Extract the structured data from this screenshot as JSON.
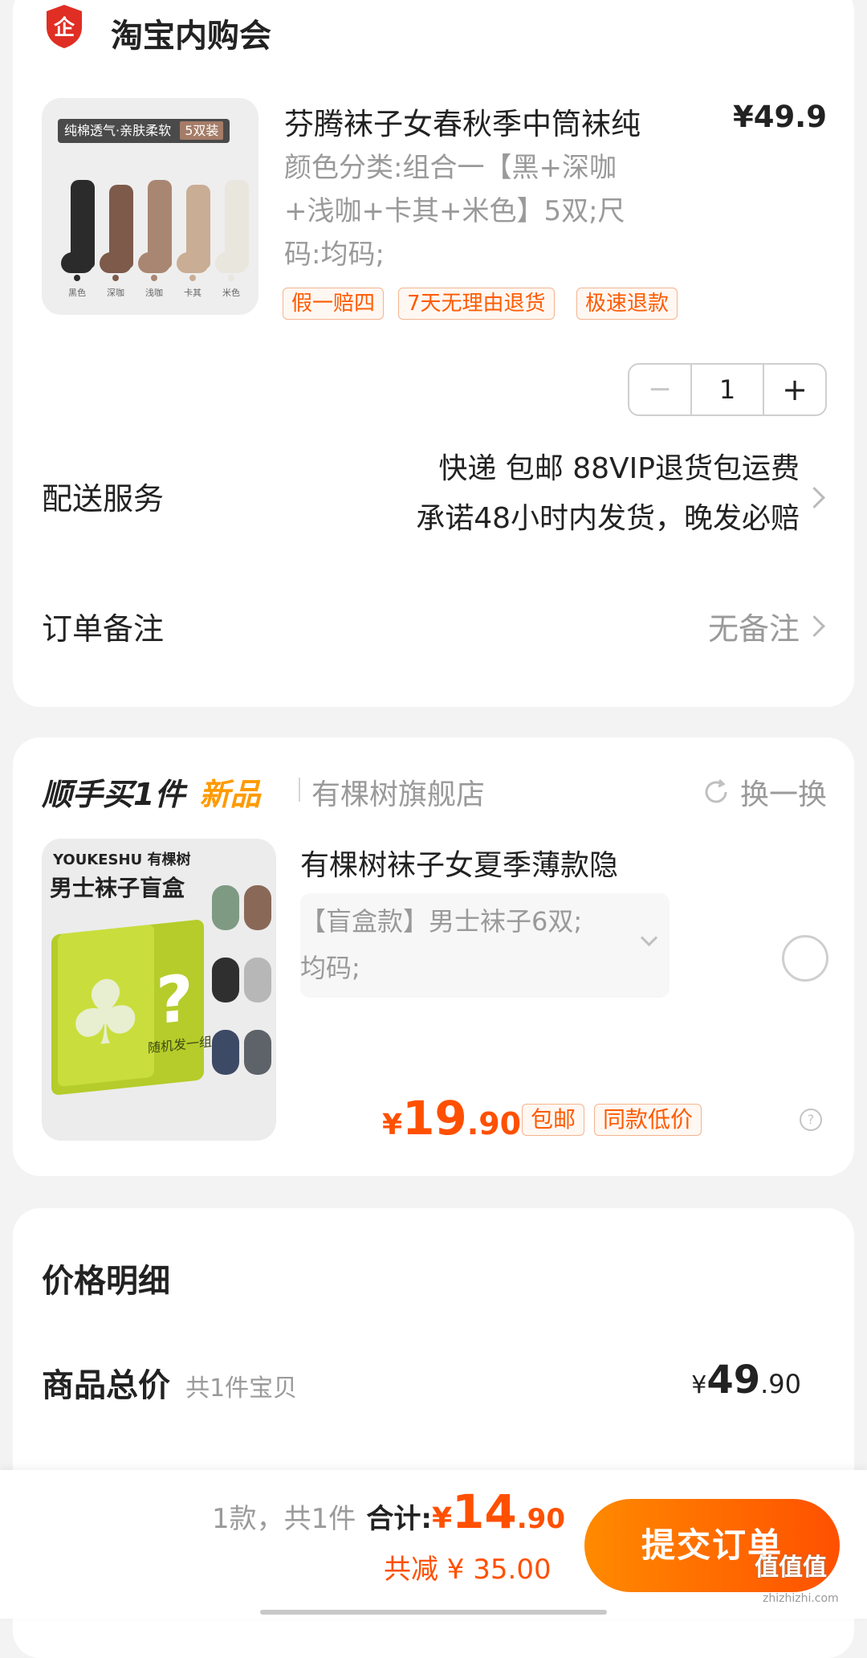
{
  "shop": {
    "name": "淘宝内购会",
    "badge_glyph": "企"
  },
  "product": {
    "title": "芬腾袜子女春秋季中筒袜纯",
    "price": "¥49.9",
    "sku_lines": [
      "颜色分类:组合一【黑+深咖",
      "+浅咖+卡其+米色】5双;尺",
      "码:均码;"
    ],
    "tags": [
      "假一赔四",
      "7天无理由退货",
      "极速退款"
    ],
    "image_banner": "纯棉透气·亲肤柔软",
    "image_badge": "5双装",
    "sock_colors": [
      {
        "label": "黑色",
        "color": "#2b2b2b"
      },
      {
        "label": "深咖",
        "color": "#7d5a4a"
      },
      {
        "label": "浅咖",
        "color": "#a98672"
      },
      {
        "label": "卡其",
        "color": "#c9ad94"
      },
      {
        "label": "米色",
        "color": "#e9e6de"
      }
    ],
    "quantity": "1",
    "minus_glyph": "−",
    "plus_glyph": "+"
  },
  "delivery": {
    "label": "配送服务",
    "line1": "快递 包邮 88VIP退货包运费",
    "line2": "承诺48小时内发货，晚发必赔"
  },
  "remark": {
    "label": "订单备注",
    "value": "无备注"
  },
  "addon": {
    "heading": "顺手买1件",
    "heading_tag": "新品",
    "store": "有棵树旗舰店",
    "refresh": "换一换",
    "image_brand": "YOUKESHU 有棵树",
    "image_title": "男士袜子盲盒",
    "image_box_text": "随机发一组",
    "title": "有棵树袜子女夏季薄款隐",
    "sku_lines": [
      "【盲盒款】男士袜子6双;",
      "均码;"
    ],
    "price_symbol": "¥",
    "price_int": "19",
    "price_dec": ".90",
    "tags": [
      "包邮",
      "同款低价"
    ],
    "help_glyph": "?"
  },
  "price_detail": {
    "title": "价格明细",
    "total_label": "商品总价",
    "total_sub": "共1件宝贝",
    "total_symbol": "¥",
    "total_int": "49",
    "total_dec": ".90"
  },
  "footer": {
    "count": "1款，共1件",
    "sum_label": "合计:",
    "sum_symbol": "¥",
    "sum_int": "14",
    "sum_dec": ".90",
    "discount": "共减 ¥ 35.00",
    "submit": "提交订单",
    "watermark": "值值值",
    "watermark_url": "zhizhizhi.com"
  },
  "colors": {
    "accent": "#ff5000",
    "button_start": "#ff8a00",
    "button_end": "#ff5000",
    "shop_red": "#e02e24"
  }
}
